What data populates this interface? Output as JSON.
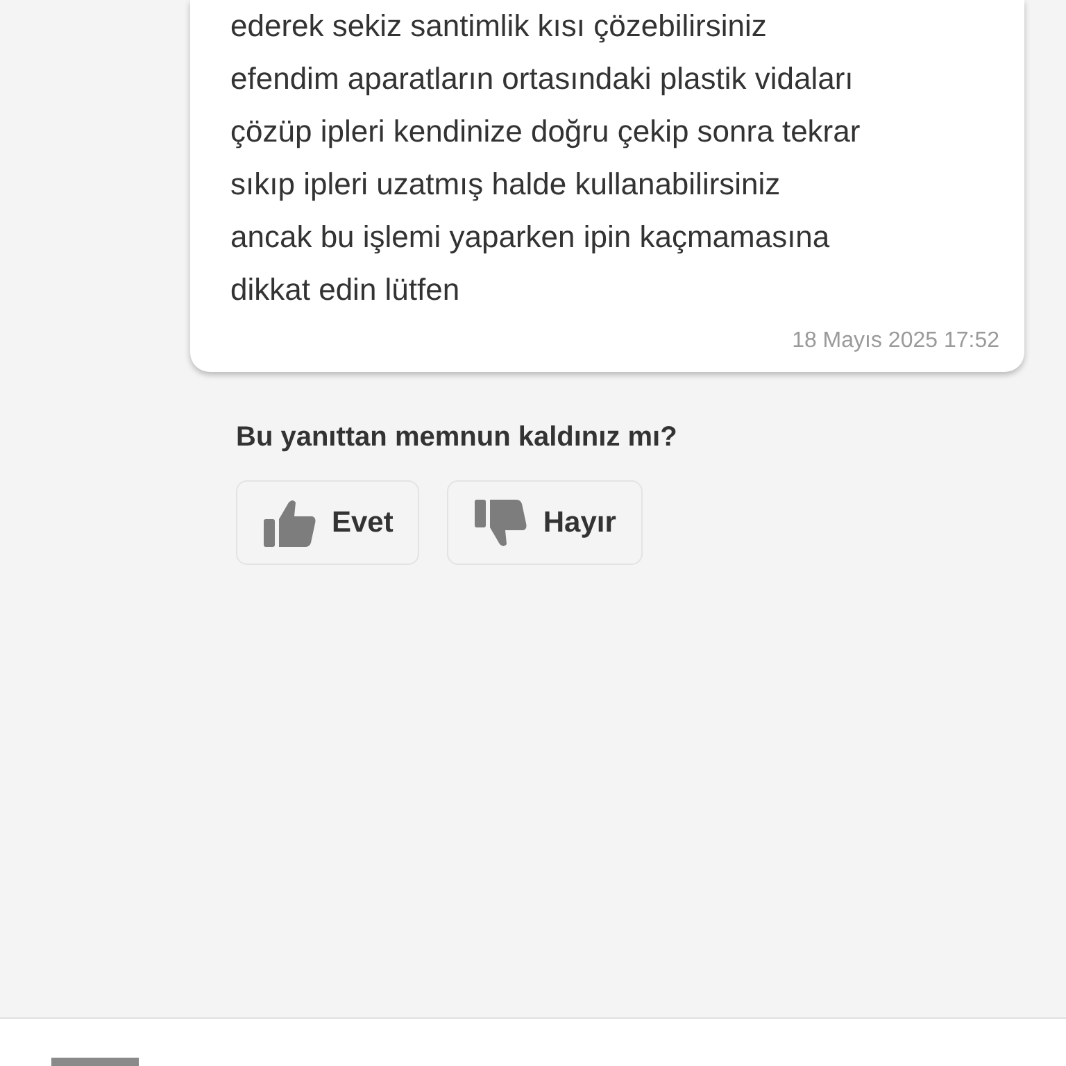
{
  "message": {
    "lines": [
      "ederek sekiz santimlik kısı çözebilirsiniz",
      "efendim aparatların ortasındaki plastik vidaları",
      "çözüp ipleri kendinize doğru çekip sonra tekrar",
      "sıkıp ipleri uzatmış halde kullanabilirsiniz",
      "ancak bu işlemi yaparken ipin kaçmamasına",
      "dikkat edin lütfen"
    ],
    "timestamp": "18 Mayıs 2025 17:52"
  },
  "feedback": {
    "question": "Bu yanıttan memnun kaldınız mı?",
    "buttons": [
      {
        "kind": "up",
        "label": "Evet"
      },
      {
        "kind": "down",
        "label": "Hayır"
      }
    ]
  }
}
